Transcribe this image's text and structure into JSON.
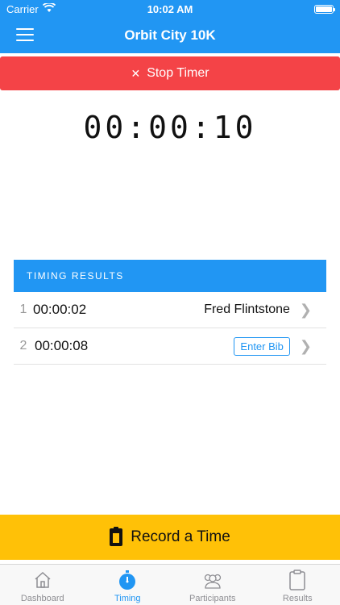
{
  "status": {
    "carrier": "Carrier",
    "time": "10:02 AM"
  },
  "nav": {
    "title": "Orbit City 10K"
  },
  "stop": {
    "label": "Stop Timer"
  },
  "timer": {
    "display": "00:00:10"
  },
  "results": {
    "header": "TIMING RESULTS",
    "rows": [
      {
        "index": "1",
        "time": "00:00:02",
        "name": "Fred Flintstone"
      },
      {
        "index": "2",
        "time": "00:00:08",
        "action": "Enter Bib"
      }
    ]
  },
  "record": {
    "label": "Record a Time"
  },
  "tabs": [
    {
      "label": "Dashboard",
      "icon": "home-icon",
      "active": false
    },
    {
      "label": "Timing",
      "icon": "stopwatch-icon",
      "active": true
    },
    {
      "label": "Participants",
      "icon": "people-icon",
      "active": false
    },
    {
      "label": "Results",
      "icon": "clipboard-icon",
      "active": false
    }
  ],
  "colors": {
    "primary": "#2196f3",
    "danger": "#f44347",
    "accent": "#ffc107"
  }
}
